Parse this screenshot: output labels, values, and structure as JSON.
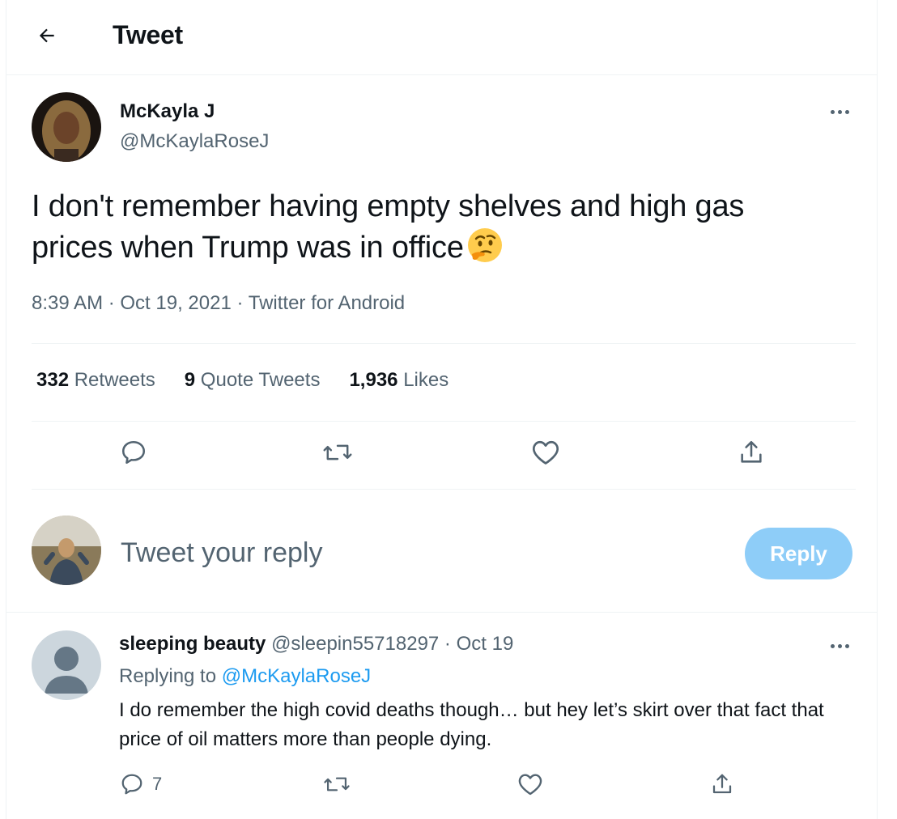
{
  "header": {
    "title": "Tweet"
  },
  "tweet": {
    "author_name": "McKayla J",
    "author_handle": "@McKaylaRoseJ",
    "text": "I don't remember having empty shelves and high gas prices when Trump was in office",
    "emoji": "thinking-face-icon",
    "time": "8:39 AM",
    "date": "Oct 19, 2021",
    "source": "Twitter for Android",
    "stats": {
      "retweets_count": "332",
      "retweets_label": "Retweets",
      "quotes_count": "9",
      "quotes_label": "Quote Tweets",
      "likes_count": "1,936",
      "likes_label": "Likes"
    }
  },
  "composer": {
    "placeholder": "Tweet your reply",
    "button_label": "Reply"
  },
  "reply": {
    "author_name": "sleeping beauty",
    "author_handle": "@sleepin55718297",
    "date": "Oct 19",
    "replying_prefix": "Replying to",
    "replying_to": "@McKaylaRoseJ",
    "text": "I do remember the high covid deaths though… but hey let’s skirt over that fact that price of oil matters more than people dying.",
    "reply_count": "7"
  },
  "colors": {
    "accent": "#1d9bf0",
    "reply_button_disabled": "#8ecdf8",
    "secondary_text": "#536471",
    "divider": "#eff3f4"
  }
}
